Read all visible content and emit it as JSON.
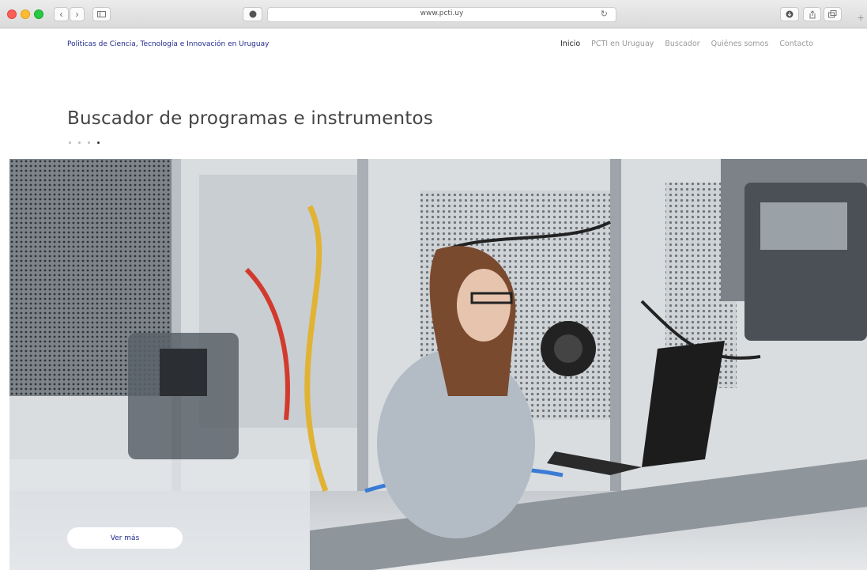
{
  "browser": {
    "url": "www.pcti.uy"
  },
  "site": {
    "title": "Politicas de Ciencia, Tecnología e Innovación en Uruguay"
  },
  "nav": {
    "items": [
      {
        "label": "Inicio",
        "active": true
      },
      {
        "label": "PCTI en Uruguay",
        "active": false
      },
      {
        "label": "Buscador",
        "active": false
      },
      {
        "label": "Quiénes somos",
        "active": false
      },
      {
        "label": "Contacto",
        "active": false
      }
    ]
  },
  "hero": {
    "heading": "Buscador de programas e instrumentos",
    "slides": 4,
    "active_slide": 4,
    "button_label": "Ver más"
  },
  "colors": {
    "link_blue": "#1f2a8c",
    "button_bg": "#ffffff"
  }
}
